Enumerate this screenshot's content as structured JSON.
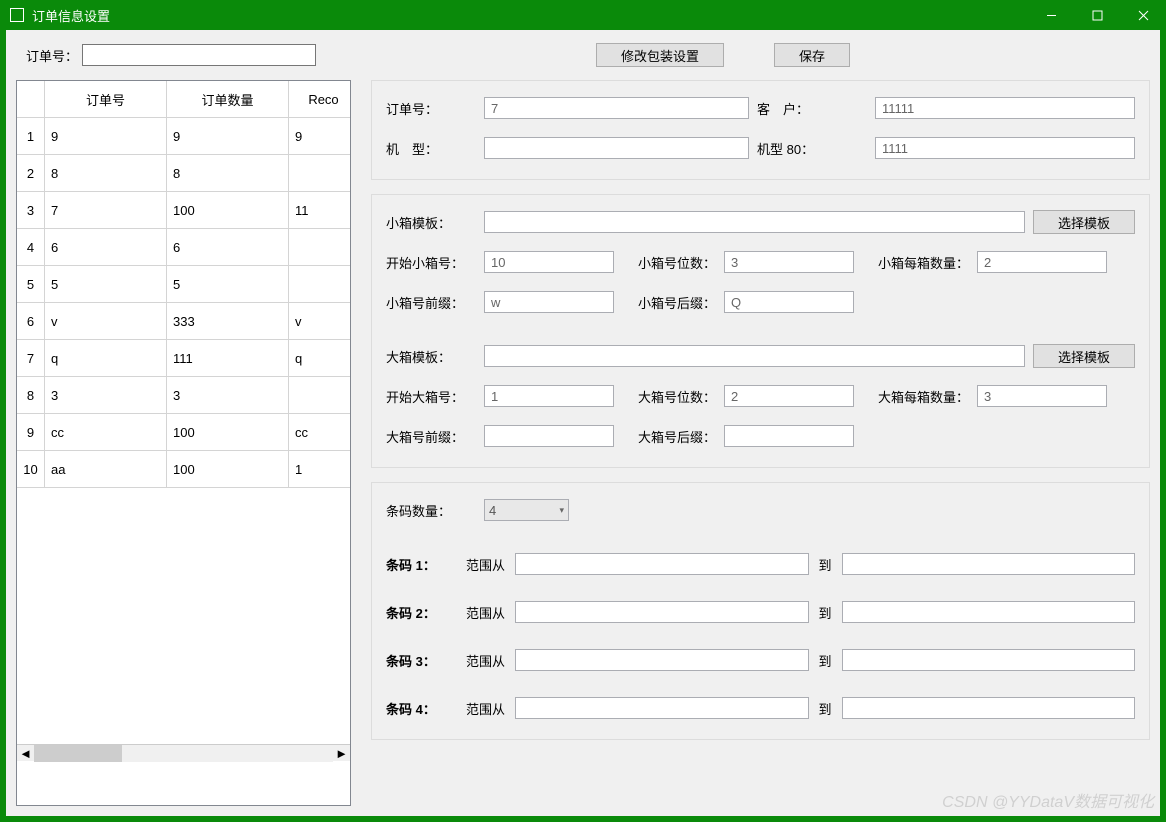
{
  "window": {
    "title": "订单信息设置"
  },
  "top": {
    "order_label": "订单号：",
    "order_value": "",
    "btn_modify": "修改包装设置",
    "btn_save": "保存"
  },
  "gridHeaders": {
    "col1": "订单号",
    "col2": "订单数量",
    "col3": "Reco"
  },
  "gridRows": [
    {
      "n": "1",
      "c1": "9",
      "c2": "9",
      "c3": "9"
    },
    {
      "n": "2",
      "c1": "8",
      "c2": "8",
      "c3": ""
    },
    {
      "n": "3",
      "c1": "7",
      "c2": "100",
      "c3": "11"
    },
    {
      "n": "4",
      "c1": "6",
      "c2": "6",
      "c3": ""
    },
    {
      "n": "5",
      "c1": "5",
      "c2": "5",
      "c3": ""
    },
    {
      "n": "6",
      "c1": "v",
      "c2": "333",
      "c3": "v"
    },
    {
      "n": "7",
      "c1": "q",
      "c2": "111",
      "c3": "q"
    },
    {
      "n": "8",
      "c1": "3",
      "c2": "3",
      "c3": ""
    },
    {
      "n": "9",
      "c1": "cc",
      "c2": "100",
      "c3": "cc"
    },
    {
      "n": "10",
      "c1": "aa",
      "c2": "100",
      "c3": "1"
    }
  ],
  "details": {
    "order_no_lbl": "订单号：",
    "order_no": "7",
    "customer_lbl": "客　户：",
    "customer": "11111",
    "model_lbl": "机　型：",
    "model": "",
    "model80_lbl": "机型 80：",
    "model80": "1111"
  },
  "smallBox": {
    "template_lbl": "小箱模板：",
    "choose": "选择模板",
    "start_lbl": "开始小箱号：",
    "start": "10",
    "digits_lbl": "小箱号位数：",
    "digits": "3",
    "qty_lbl": "小箱每箱数量：",
    "qty": "2",
    "prefix_lbl": "小箱号前缀：",
    "prefix": "w",
    "suffix_lbl": "小箱号后缀：",
    "suffix": "Q"
  },
  "bigBox": {
    "template_lbl": "大箱模板：",
    "choose": "选择模板",
    "start_lbl": "开始大箱号：",
    "start": "1",
    "digits_lbl": "大箱号位数：",
    "digits": "2",
    "qty_lbl": "大箱每箱数量：",
    "qty": "3",
    "prefix_lbl": "大箱号前缀：",
    "prefix": "",
    "suffix_lbl": "大箱号后缀：",
    "suffix": ""
  },
  "barcode": {
    "count_lbl": "条码数量：",
    "count": "4",
    "rows": [
      {
        "lbl": "条码 1：",
        "from": "范围从",
        "to": "到"
      },
      {
        "lbl": "条码 2：",
        "from": "范围从",
        "to": "到"
      },
      {
        "lbl": "条码 3：",
        "from": "范围从",
        "to": "到"
      },
      {
        "lbl": "条码 4：",
        "from": "范围从",
        "to": "到"
      }
    ]
  },
  "watermark": "CSDN @YYDataV数据可视化"
}
